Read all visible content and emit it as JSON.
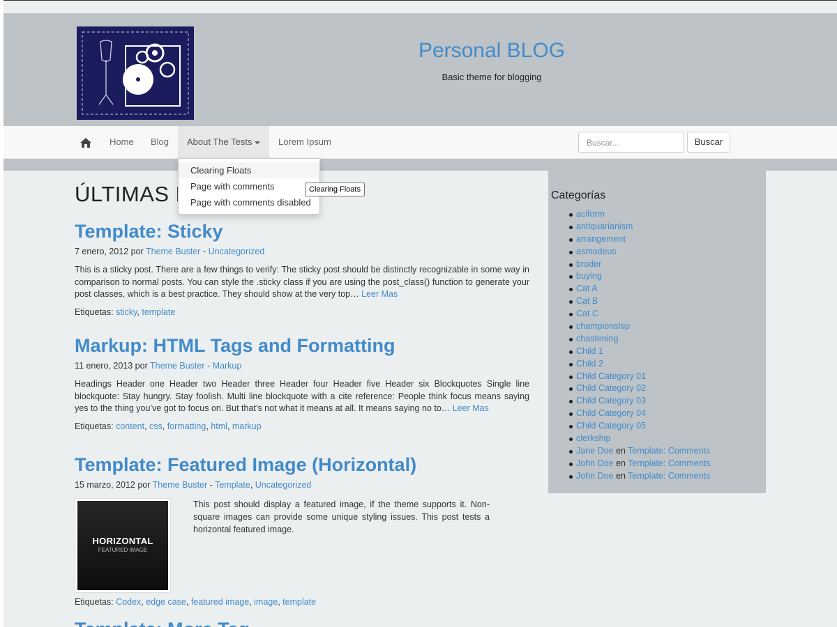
{
  "header": {
    "site_title": "Personal BLOG",
    "site_description": "Basic theme for blogging",
    "logo_icon": "logo-mannequin-gears-icon"
  },
  "nav": {
    "home_icon": "home-icon",
    "items": [
      {
        "label": "Home"
      },
      {
        "label": "Blog"
      },
      {
        "label": "About The Tests"
      },
      {
        "label": "Lorem Ipsum"
      }
    ],
    "search_placeholder": "Buscar...",
    "search_button": "Buscar"
  },
  "dropdown": {
    "items": [
      "Clearing Floats",
      "Page with comments",
      "Page with comments disabled"
    ]
  },
  "tooltip": "Clearing Floats",
  "main": {
    "heading": "ÚLTIMAS ENTRADAS",
    "posts": [
      {
        "title": "Template: Sticky",
        "date": "7 enero, 2012",
        "by": "por",
        "author": "Theme Buster",
        "sep": "-",
        "categories": [
          "Uncategorized"
        ],
        "excerpt": "This is a sticky post. There are a few things to verify: The sticky post should be distinctly recognizable in some way in comparison to normal posts. You can style the .sticky class if you are using the post_class() function to generate your post classes, which is a best practice. They should show at the very top…",
        "read_more": "Leer Mas",
        "tags_label": "Etiquetas:",
        "tags": [
          "sticky",
          "template"
        ]
      },
      {
        "title": "Markup: HTML Tags and Formatting",
        "date": "11 enero, 2013",
        "by": "por",
        "author": "Theme Buster",
        "sep": "-",
        "categories": [
          "Markup"
        ],
        "excerpt": "Headings Header one Header two Header three Header four Header five Header six Blockquotes Single line blockquote: Stay hungry. Stay foolish. Multi line blockquote with a cite reference: People think focus means saying yes to the thing you’ve got to focus on. But that’s not what it means at all. It means saying no to…",
        "read_more": "Leer Mas",
        "tags_label": "Etiquetas:",
        "tags": [
          "content",
          "css",
          "formatting",
          "html",
          "markup"
        ]
      },
      {
        "title": "Template: Featured Image (Horizontal)",
        "date": "15 marzo, 2012",
        "by": "por",
        "author": "Theme Buster",
        "sep": "-",
        "categories": [
          "Template",
          "Uncategorized"
        ],
        "excerpt": "This post should display a featured image, if the theme supports it. Non-square images can provide some unique styling issues. This post tests a horizontal featured image.",
        "thumb_big": "HORIZONTAL",
        "thumb_small": "FEATURED IMAGE",
        "tags_label": "Etiquetas:",
        "tags": [
          "Codex",
          "edge case",
          "featured image",
          "image",
          "template"
        ]
      },
      {
        "title": "Template: More Tag"
      }
    ]
  },
  "sidebar": {
    "title": "Categorías",
    "categories": [
      "aciform",
      "antiquarianism",
      "arrangement",
      "asmodeus",
      "broder",
      "buying",
      "Cat A",
      "Cat B",
      "Cat C",
      "championship",
      "chastening",
      "Child 1",
      "Child 2",
      "Child Category 01",
      "Child Category 02",
      "Child Category 03",
      "Child Category 04",
      "Child Category 05",
      "clerkship"
    ],
    "comments": [
      {
        "author": "Jane Doe",
        "on": "en",
        "post": "Template: Comments"
      },
      {
        "author": "John Doe",
        "on": "en",
        "post": "Template: Comments"
      },
      {
        "author": "John Doe",
        "on": "en",
        "post": "Template: Comments"
      }
    ]
  },
  "colors": {
    "link": "#428bca",
    "band": "#bdc3c7",
    "page_bg": "#eceff0",
    "logo_bg": "#1b1c5e"
  }
}
